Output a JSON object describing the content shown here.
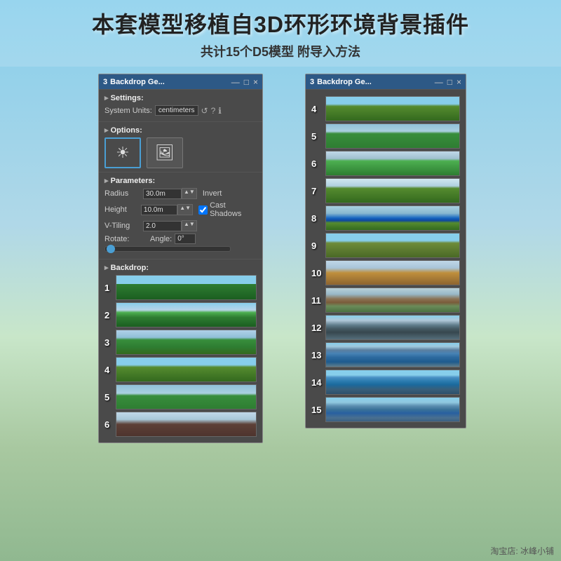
{
  "page": {
    "title_main": "本套模型移植自3D环形环境背景插件",
    "title_sub": "共计15个D5模型 附导入方法",
    "credit": "淘宝店: 冰峰小铺"
  },
  "panel_left": {
    "window_number": "3",
    "title": "Backdrop Ge...",
    "minimize": "—",
    "maximize": "□",
    "close": "×",
    "settings": {
      "header": "Settings:",
      "system_units_label": "System Units:",
      "system_units_value": "centimeters",
      "btn_refresh": "↺",
      "btn_help": "?",
      "btn_info": "ℹ"
    },
    "options": {
      "header": "Options:"
    },
    "parameters": {
      "header": "Parameters:",
      "radius_label": "Radius",
      "radius_value": "30.0m",
      "invert_label": "Invert",
      "height_label": "Height",
      "height_value": "10.0m",
      "cast_shadows_label": "Cast Shadows",
      "vtiling_label": "V-Tiling",
      "vtiling_value": "2.0",
      "rotate_label": "Rotate:",
      "angle_label": "Angle:",
      "angle_value": "0°"
    },
    "backdrop": {
      "header": "Backdrop:",
      "items": [
        {
          "num": "1",
          "class": "tree-1"
        },
        {
          "num": "2",
          "class": "tree-2"
        },
        {
          "num": "3",
          "class": "tree-3"
        },
        {
          "num": "4",
          "class": "tree-4"
        },
        {
          "num": "5",
          "class": "tree-5"
        },
        {
          "num": "6",
          "class": "tree-6"
        }
      ]
    }
  },
  "panel_right": {
    "window_number": "3",
    "title": "Backdrop Ge...",
    "minimize": "—",
    "maximize": "□",
    "close": "×",
    "backdrop": {
      "items": [
        {
          "num": "4",
          "class": "tree-r4"
        },
        {
          "num": "5",
          "class": "tree-r5"
        },
        {
          "num": "6",
          "class": "tree-r6"
        },
        {
          "num": "7",
          "class": "tree-r7"
        },
        {
          "num": "8",
          "class": "tree-r8"
        },
        {
          "num": "9",
          "class": "tree-r9"
        },
        {
          "num": "10",
          "class": "tree-r10"
        },
        {
          "num": "11",
          "class": "tree-r11"
        },
        {
          "num": "12",
          "class": "tree-r12"
        },
        {
          "num": "13",
          "class": "tree-r13"
        },
        {
          "num": "14",
          "class": "tree-r14"
        },
        {
          "num": "15",
          "class": "tree-r15"
        }
      ]
    }
  }
}
